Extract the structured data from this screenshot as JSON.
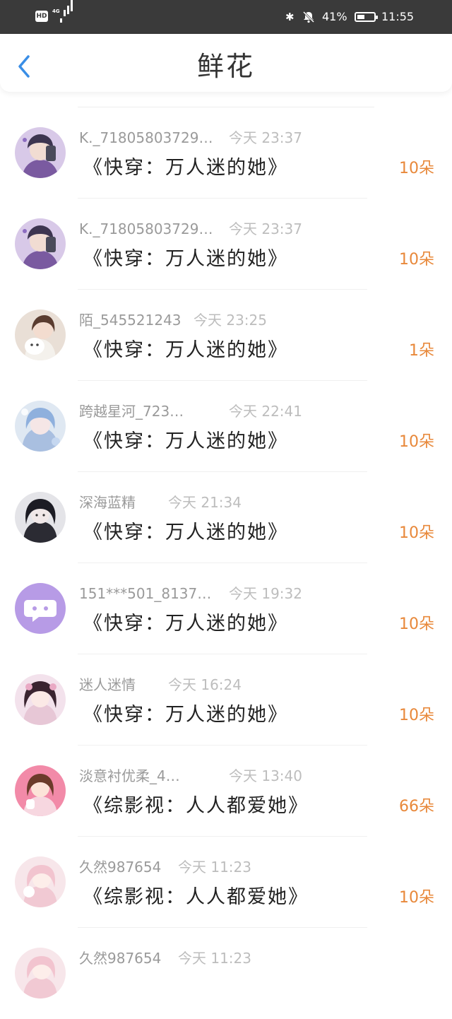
{
  "status_bar": {
    "hd_label": "HD",
    "network_label": "4G",
    "bluetooth_icon": "bluetooth-icon",
    "mute_icon": "mute-icon",
    "battery_percent": "41%",
    "battery_level": 0.41,
    "time": "11:55"
  },
  "header": {
    "back_icon": "chevron-left-icon",
    "title": "鲜花"
  },
  "accent_color": "#3a8ee6",
  "count_color": "#e8883a",
  "items": [
    {
      "user": "K._71805803729…",
      "time": "今天 23:37",
      "book": "《快穿：万人迷的她》",
      "count": "10朵",
      "avatar": "avatar-boy"
    },
    {
      "user": "K._71805803729…",
      "time": "今天 23:37",
      "book": "《快穿：万人迷的她》",
      "count": "10朵",
      "avatar": "avatar-boy"
    },
    {
      "user": "陌_545521243",
      "time": "今天 23:25",
      "book": "《快穿：万人迷的她》",
      "count": "1朵",
      "avatar": "avatar-girl-cat"
    },
    {
      "user": "跨越星河_723…",
      "time": "今天 22:41",
      "book": "《快穿：万人迷的她》",
      "count": "10朵",
      "avatar": "avatar-blue-girl"
    },
    {
      "user": "深海蓝精",
      "time": "今天 21:34",
      "book": "《快穿：万人迷的她》",
      "count": "10朵",
      "avatar": "avatar-dark-girl"
    },
    {
      "user": "151***501_8137…",
      "time": "今天 19:32",
      "book": "《快穿：万人迷的她》",
      "count": "10朵",
      "avatar": "avatar-default-chat"
    },
    {
      "user": "迷人迷情",
      "time": "今天 16:24",
      "book": "《快穿：万人迷的她》",
      "count": "10朵",
      "avatar": "avatar-anime-girl"
    },
    {
      "user": "淡意衬优柔_4…",
      "time": "今天 13:40",
      "book": "《综影视：人人都爱她》",
      "count": "66朵",
      "avatar": "avatar-pink-girl"
    },
    {
      "user": "久然987654",
      "time": "今天 11:23",
      "book": "《综影视：人人都爱她》",
      "count": "10朵",
      "avatar": "avatar-pastel-girl"
    },
    {
      "user": "久然987654",
      "time": "今天 11:23",
      "book": "",
      "count": "",
      "avatar": "avatar-pastel-girl"
    }
  ]
}
